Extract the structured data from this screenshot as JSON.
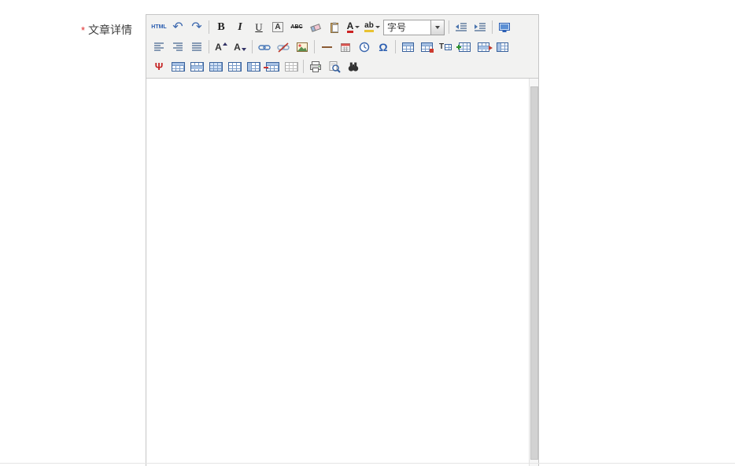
{
  "form": {
    "required_marker": "*",
    "field_label": "文章详情"
  },
  "toolbar": {
    "source": "HTML",
    "undo": "↶",
    "redo": "↷",
    "bold": "B",
    "italic": "I",
    "underline": "U",
    "char_border": "A",
    "strikethrough": "ABC",
    "font_color": "A",
    "highlight": "ab",
    "font_size_value": "字号",
    "increase_font": "A",
    "decrease_font": "A",
    "horizontal_rule_name": "horizontal-rule",
    "special_char": "Ω",
    "cell_props_glyph": "T",
    "delete_table_glyph": "Ψ"
  },
  "editor": {
    "content_text": ""
  },
  "colors": {
    "accent_blue": "#2a5db0",
    "toolbar_bg": "#f2f2f1",
    "editor_border": "#c6c6c6",
    "required_red": "#e02b2b",
    "table_icon_blue": "#39629c"
  }
}
